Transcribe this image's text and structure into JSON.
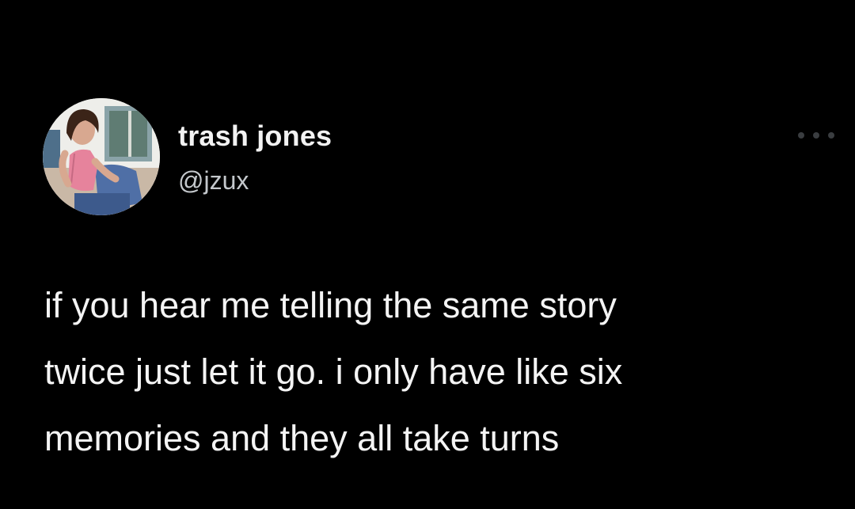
{
  "tweet": {
    "author": {
      "display_name": "trash jones",
      "handle": "@jzux",
      "avatar_icon": "profile-photo"
    },
    "more_icon": "more-horizontal-icon",
    "text_lines": [
      "if you hear me telling the same story",
      "twice just let it go. i only have like six",
      "memories and they all take turns"
    ]
  },
  "colors": {
    "background": "#000000",
    "text": "#f4f4f4",
    "handle": "#c4c8cc",
    "more_icon": "#3a3d40"
  }
}
